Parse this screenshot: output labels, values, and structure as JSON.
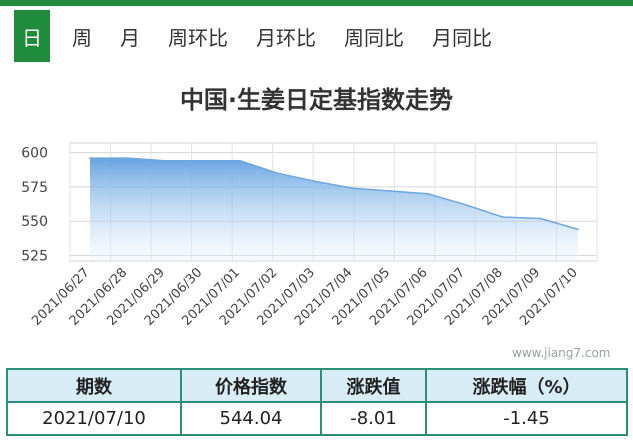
{
  "tabs": [
    {
      "label": "日",
      "active": true
    },
    {
      "label": "周"
    },
    {
      "label": "月"
    },
    {
      "label": "周环比"
    },
    {
      "label": "月环比"
    },
    {
      "label": "周同比"
    },
    {
      "label": "月同比"
    }
  ],
  "colors": {
    "accent": "#1e8c3a",
    "line": "#6fa6dc",
    "table_border": "#2a8f76",
    "table_header_bg": "#d8ecf5"
  },
  "chart_data": {
    "type": "area",
    "title": "中国·生姜日定基指数走势",
    "x": [
      "2021/06/27",
      "2021/06/28",
      "2021/06/29",
      "2021/06/30",
      "2021/07/01",
      "2021/07/02",
      "2021/07/03",
      "2021/07/04",
      "2021/07/05",
      "2021/07/06",
      "2021/07/07",
      "2021/07/08",
      "2021/07/09",
      "2021/07/10"
    ],
    "series": [
      {
        "values": [
          596,
          596,
          594,
          594,
          594,
          585,
          579,
          574,
          572,
          570,
          562,
          553,
          552,
          544.04
        ]
      }
    ],
    "yticks": [
      525,
      550,
      575,
      600
    ],
    "ylim": [
      521,
      607
    ],
    "grid": true
  },
  "watermark": "www.jiang7.com",
  "table": {
    "headers": [
      "期数",
      "价格指数",
      "涨跌值",
      "涨跌幅（%）"
    ],
    "rows": [
      [
        "2021/07/10",
        "544.04",
        "-8.01",
        "-1.45"
      ]
    ]
  }
}
